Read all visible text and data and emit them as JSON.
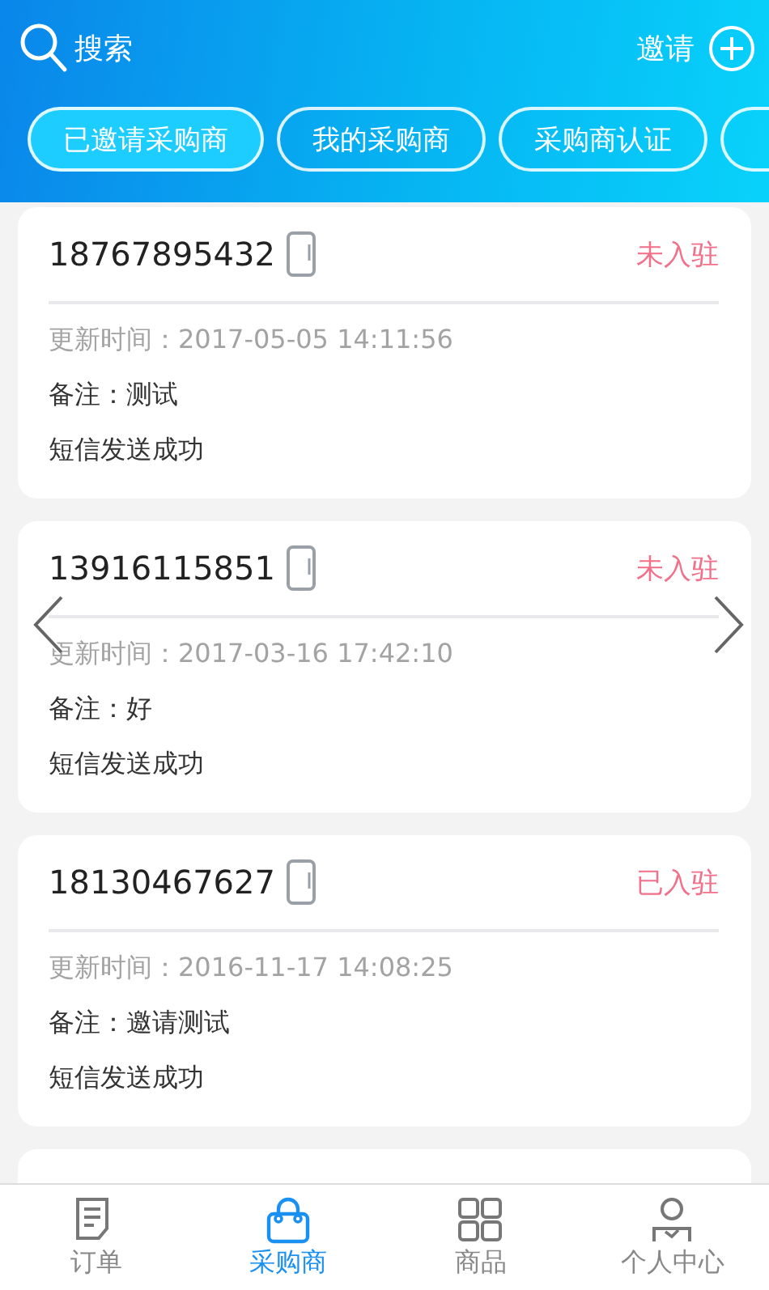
{
  "header": {
    "search_label": "搜索",
    "invite_label": "邀请"
  },
  "tabs": [
    {
      "label": "已邀请采购商",
      "selected": true
    },
    {
      "label": "我的采购商",
      "selected": false
    },
    {
      "label": "采购商认证",
      "selected": false
    }
  ],
  "invitations": [
    {
      "phone": "18767895432",
      "status": "未入驻",
      "updated": "更新时间：2017-05-05 14:11:56",
      "note": "备注：测试",
      "sms": "短信发送成功"
    },
    {
      "phone": "13916115851",
      "status": "未入驻",
      "updated": "更新时间：2017-03-16 17:42:10",
      "note": "备注：好",
      "sms": "短信发送成功"
    },
    {
      "phone": "18130467627",
      "status": "已入驻",
      "updated": "更新时间：2016-11-17 14:08:25",
      "note": "备注：邀请测试",
      "sms": "短信发送成功"
    }
  ],
  "bottom_nav": [
    {
      "label": "订单",
      "kind": "order",
      "selected": false
    },
    {
      "label": "采购商",
      "kind": "bag",
      "selected": true
    },
    {
      "label": "商品",
      "kind": "grid",
      "selected": false
    },
    {
      "label": "个人中心",
      "kind": "person",
      "selected": false
    }
  ]
}
